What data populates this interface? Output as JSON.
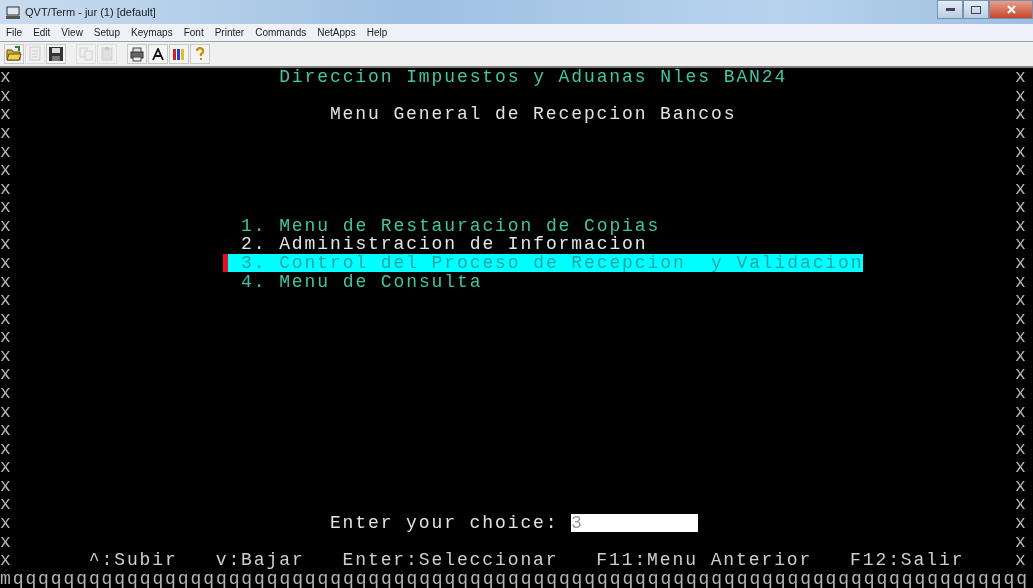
{
  "window": {
    "title": "QVT/Term - jur (1) [default]"
  },
  "menu": [
    "File",
    "Edit",
    "View",
    "Setup",
    "Keymaps",
    "Font",
    "Printer",
    "Commands",
    "NetApps",
    "Help"
  ],
  "toolbar": [
    {
      "kind": "open",
      "disabled": false
    },
    {
      "kind": "blank",
      "disabled": true
    },
    {
      "kind": "save",
      "disabled": false
    },
    {
      "kind": "copy",
      "disabled": true
    },
    {
      "kind": "paste",
      "disabled": true
    },
    {
      "kind": "print",
      "disabled": false
    },
    {
      "kind": "font",
      "disabled": false
    },
    {
      "kind": "colors",
      "disabled": false
    },
    {
      "kind": "help",
      "disabled": false
    }
  ],
  "terminal": {
    "title": "Direccion Impuestos y Aduanas Nles BAN24",
    "subtitle": "Menu General de Recepcion Bancos",
    "menu_items": [
      {
        "text": "1. Menu de Restauracion de Copias",
        "color": "#3fc4a4",
        "selected": false
      },
      {
        "text": "2. Administracion de Informacion",
        "color": "#e6e6e6",
        "selected": false
      },
      {
        "text": "3. Control del Proceso de Recepcion  y Validacion",
        "selected": true
      },
      {
        "text": "4. Menu de Consulta",
        "color": "#3fc4a4",
        "selected": false
      }
    ],
    "prompt": {
      "label": "Enter your choice:",
      "value": "3"
    },
    "keys": [
      "^:Subir",
      "v:Bajar",
      "Enter:Seleccionar",
      "F11:Menu Anterior",
      "F12:Salir"
    ],
    "left_border": [
      "x",
      "x",
      "x",
      "x",
      "x",
      "x",
      "x",
      "x",
      "x",
      "x",
      "x",
      "x",
      "x",
      "x",
      "x",
      "x",
      "x",
      "x",
      "x",
      "x",
      "x",
      "x",
      "x",
      "x",
      "x",
      "x",
      "x"
    ],
    "right_border": [
      "x",
      "x",
      "x",
      "x",
      "x",
      "x",
      "x",
      "x",
      "x",
      "x",
      "x",
      "x",
      "x",
      "x",
      "x",
      "x",
      "x",
      "x",
      "x",
      "x",
      "x",
      "x",
      "x",
      "x",
      "x",
      "x",
      "x"
    ],
    "bottom_border": "mqqqqqqqqqqqqqqqqqqqqqqqqqqqqqqqqqqqqqqqqqqqqqqqqqqqqqqqqqqqqqqqqqqqqqqqqqqqqqqqq"
  }
}
